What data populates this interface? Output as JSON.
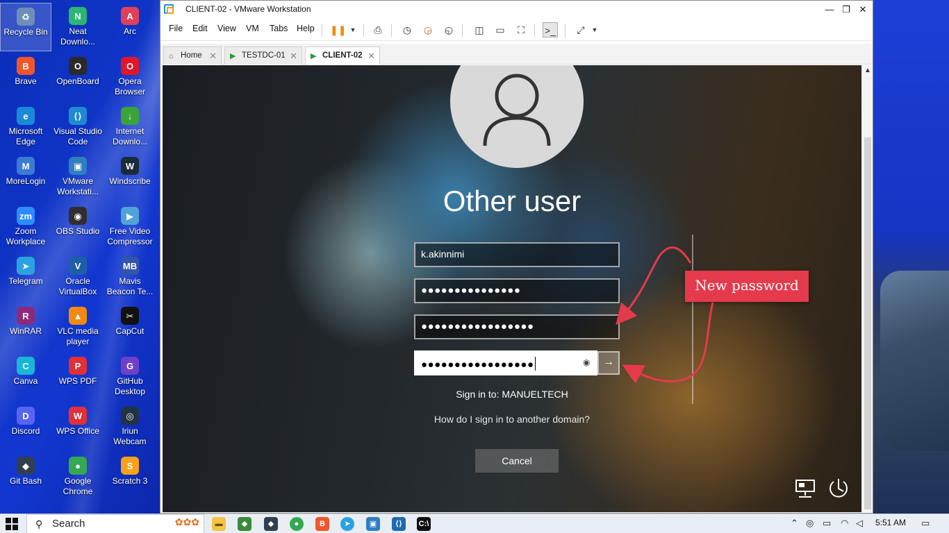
{
  "desktop": {
    "icons": [
      {
        "label": "Recycle Bin",
        "icon": "recycle-bin-icon",
        "color": "#6f8fb8",
        "glyph": "♻"
      },
      {
        "label": "Neat Downlo...",
        "icon": "neat-download-icon",
        "color": "#2bb673",
        "glyph": "N"
      },
      {
        "label": "Arc",
        "icon": "arc-icon",
        "color": "#e0405a",
        "glyph": "A"
      },
      {
        "label": "Brave",
        "icon": "brave-icon",
        "color": "#f1562b",
        "glyph": "B"
      },
      {
        "label": "OpenBoard",
        "icon": "openboard-icon",
        "color": "#2a2a2a",
        "glyph": "O"
      },
      {
        "label": "Opera Browser",
        "icon": "opera-icon",
        "color": "#e0162b",
        "glyph": "O"
      },
      {
        "label": "Microsoft Edge",
        "icon": "edge-icon",
        "color": "#1a8ad6",
        "glyph": "e"
      },
      {
        "label": "Visual Studio Code",
        "icon": "vscode-icon",
        "color": "#1f8ad2",
        "glyph": "⟨⟩"
      },
      {
        "label": "Internet Downlo...",
        "icon": "idm-icon",
        "color": "#3aa33a",
        "glyph": "↓"
      },
      {
        "label": "MoreLogin",
        "icon": "morelogin-icon",
        "color": "#3a7bd5",
        "glyph": "M"
      },
      {
        "label": "VMware Workstati...",
        "icon": "vmware-icon",
        "color": "#2d7fc1",
        "glyph": "▣"
      },
      {
        "label": "Windscribe",
        "icon": "windscribe-icon",
        "color": "#1b2b3c",
        "glyph": "W"
      },
      {
        "label": "Zoom Workplace",
        "icon": "zoom-icon",
        "color": "#2d8cff",
        "glyph": "zm"
      },
      {
        "label": "OBS Studio",
        "icon": "obs-icon",
        "color": "#302e31",
        "glyph": "◉"
      },
      {
        "label": "Free Video Compressor",
        "icon": "video-compressor-icon",
        "color": "#4fa3d9",
        "glyph": "▶"
      },
      {
        "label": "Telegram",
        "icon": "telegram-icon",
        "color": "#2aa3df",
        "glyph": "➤"
      },
      {
        "label": "Oracle VirtualBox",
        "icon": "virtualbox-icon",
        "color": "#1e5ea8",
        "glyph": "V"
      },
      {
        "label": "Mavis Beacon Te...",
        "icon": "mavis-beacon-icon",
        "color": "#3355aa",
        "glyph": "MB"
      },
      {
        "label": "WinRAR",
        "icon": "winrar-icon",
        "color": "#8b2a7a",
        "glyph": "R"
      },
      {
        "label": "VLC media player",
        "icon": "vlc-icon",
        "color": "#f08a10",
        "glyph": "▲"
      },
      {
        "label": "CapCut",
        "icon": "capcut-icon",
        "color": "#111111",
        "glyph": "✂"
      },
      {
        "label": "Canva",
        "icon": "canva-icon",
        "color": "#18b7d8",
        "glyph": "C"
      },
      {
        "label": "WPS PDF",
        "icon": "wps-pdf-icon",
        "color": "#e0303a",
        "glyph": "P"
      },
      {
        "label": "GitHub Desktop",
        "icon": "github-desktop-icon",
        "color": "#6e40c9",
        "glyph": "G"
      },
      {
        "label": "Discord",
        "icon": "discord-icon",
        "color": "#5865f2",
        "glyph": "D"
      },
      {
        "label": "WPS Office",
        "icon": "wps-office-icon",
        "color": "#e0303a",
        "glyph": "W"
      },
      {
        "label": "Iriun Webcam",
        "icon": "iriun-webcam-icon",
        "color": "#223344",
        "glyph": "◎"
      },
      {
        "label": "Git Bash",
        "icon": "git-bash-icon",
        "color": "#2f3f4f",
        "glyph": "◆"
      },
      {
        "label": "Google Chrome",
        "icon": "chrome-icon",
        "color": "#34a853",
        "glyph": "●"
      },
      {
        "label": "Scratch 3",
        "icon": "scratch-icon",
        "color": "#f7a21a",
        "glyph": "S"
      }
    ]
  },
  "window": {
    "title": "CLIENT-02 - VMware Workstation",
    "menu": [
      "File",
      "Edit",
      "View",
      "VM",
      "Tabs",
      "Help"
    ],
    "tabs": [
      {
        "label": "Home",
        "icon": "home-icon"
      },
      {
        "label": "TESTDC-01",
        "icon": "vm-running-icon"
      },
      {
        "label": "CLIENT-02",
        "icon": "vm-running-icon"
      }
    ]
  },
  "login": {
    "title": "Other user",
    "username": "k.akinnimi",
    "old_password_mask": "●●●●●●●●●●●●●●●",
    "new_password_mask": "●●●●●●●●●●●●●●●●●",
    "confirm_password_mask": "●●●●●●●●●●●●●●●●●",
    "sign_in_to": "Sign in to: MANUELTECH",
    "other_domain_link": "How do I sign in to another domain?",
    "cancel_label": "Cancel"
  },
  "annotation": {
    "callout_text": "New password",
    "callout_color": "#e53a4c"
  },
  "taskbar": {
    "search_placeholder": "Search",
    "time": "5:51 AM"
  }
}
